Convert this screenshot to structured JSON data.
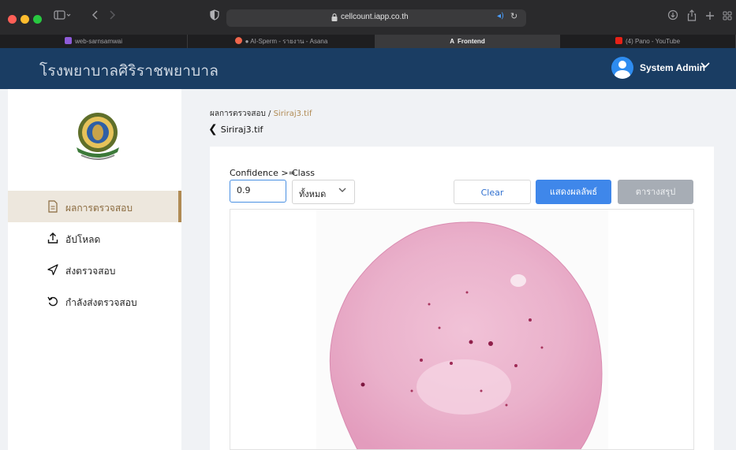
{
  "browser": {
    "url": "cellcount.iapp.co.th",
    "tabs": [
      {
        "label": "web-sarnsamwai",
        "favicon_color": "#8e5bd8"
      },
      {
        "label": "● AI-Sperm - รายงาน - Asana",
        "favicon_color": "#f0664c"
      },
      {
        "label": "Frontend",
        "favicon_color": "#dddddd",
        "active": true
      },
      {
        "label": "(4) Pano - YouTube",
        "favicon_color": "#e62117"
      }
    ]
  },
  "header": {
    "title": "โรงพยาบาลศิริราชพยาบาล",
    "user": "System Admin"
  },
  "sidebar": {
    "items": [
      {
        "label": "ผลการตรวจสอบ",
        "icon": "document-icon",
        "active": true
      },
      {
        "label": "อัปโหลด",
        "icon": "upload-icon",
        "active": false
      },
      {
        "label": "ส่งตรวจสอบ",
        "icon": "send-icon",
        "active": false
      },
      {
        "label": "กำลังส่งตรวจสอบ",
        "icon": "refresh-icon",
        "active": false
      }
    ]
  },
  "main": {
    "breadcrumb_parent": "ผลการตรวจสอบ",
    "breadcrumb_sep": " / ",
    "breadcrumb_current": "Siriraj3.tif",
    "file_title": "Siriraj3.tif",
    "confidence_label": "Confidence >=",
    "confidence_value": "0.9",
    "class_label": "Class",
    "class_value": "ทั้งหมด",
    "buttons": {
      "clear": "Clear",
      "show": "แสดงผลลัพธ์",
      "summary": "ตารางสรุป"
    }
  },
  "colors": {
    "header_bg": "#1a3d63",
    "accent_gold": "#b08a53",
    "primary_blue": "#3f87ea",
    "tissue_pink": "#e9a6c6"
  }
}
